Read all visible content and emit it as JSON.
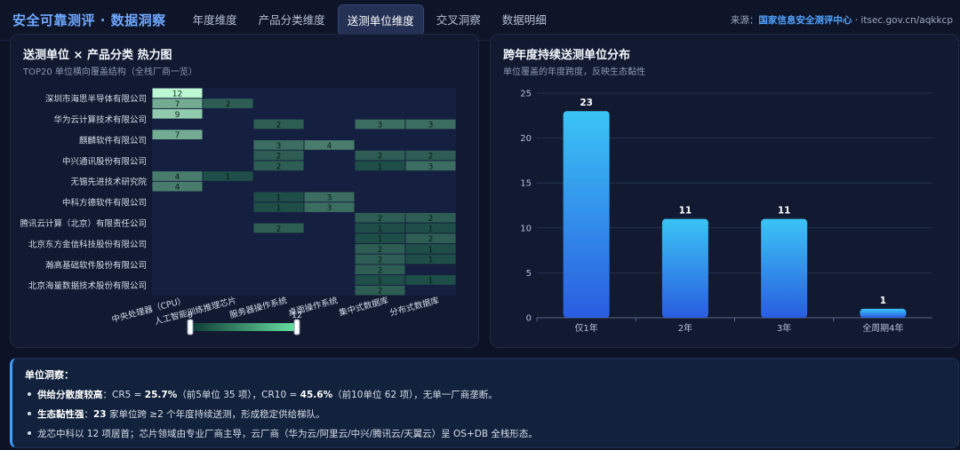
{
  "nav": {
    "brand": "安全可靠测评 · 数据洞察",
    "tabs": [
      "年度维度",
      "产品分类维度",
      "送测单位维度",
      "交叉洞察",
      "数据明细"
    ],
    "active_tab": 2,
    "source_prefix": "来源：",
    "source_org": "国家信息安全测评中心",
    "source_suffix": " · itsec.gov.cn/aqkkcp"
  },
  "heatmap_panel": {
    "title": "送测单位 × 产品分类 热力图",
    "subtitle": "TOP20 单位横向覆盖结构（全栈厂商一览）"
  },
  "bar_panel": {
    "title": "跨年度持续送测单位分布",
    "subtitle": "单位覆盖的年度跨度，反映生态黏性"
  },
  "chart_data": [
    {
      "type": "heatmap",
      "title": "送测单位 × 产品分类 热力图",
      "columns": [
        "中央处理器（CPU）",
        "人工智能训练推理芯片",
        "服务器操作系统",
        "桌面操作系统",
        "集中式数据库",
        "分布式数据库"
      ],
      "row_labels": [
        "深圳市海思半导体有限公司",
        "华为云计算技术有限公司",
        "麒麟软件有限公司",
        "中兴通讯股份有限公司",
        "无锡先进技术研究院",
        "中科方德软件有限公司",
        "腾讯云计算（北京）有限责任公司",
        "北京东方金信科技股份有限公司",
        "瀚高基础软件股份有限公司",
        "北京海量数据技术股份有限公司"
      ],
      "rows": [
        [
          12,
          0,
          0,
          0,
          0,
          0
        ],
        [
          7,
          2,
          0,
          0,
          0,
          0
        ],
        [
          9,
          0,
          0,
          0,
          0,
          0
        ],
        [
          0,
          0,
          2,
          0,
          3,
          3
        ],
        [
          7,
          0,
          0,
          0,
          0,
          0
        ],
        [
          0,
          0,
          3,
          4,
          0,
          0
        ],
        [
          0,
          0,
          2,
          0,
          2,
          2
        ],
        [
          0,
          0,
          2,
          0,
          1,
          3
        ],
        [
          4,
          1,
          0,
          0,
          0,
          0
        ],
        [
          4,
          0,
          0,
          0,
          0,
          0
        ],
        [
          0,
          0,
          1,
          3,
          0,
          0
        ],
        [
          0,
          0,
          1,
          3,
          0,
          0
        ],
        [
          0,
          0,
          0,
          0,
          2,
          2
        ],
        [
          0,
          0,
          2,
          0,
          1,
          1
        ],
        [
          0,
          0,
          0,
          0,
          1,
          2
        ],
        [
          0,
          0,
          0,
          0,
          2,
          1
        ],
        [
          0,
          0,
          0,
          0,
          2,
          1
        ],
        [
          0,
          0,
          0,
          0,
          2,
          0
        ],
        [
          0,
          0,
          0,
          0,
          1,
          1
        ],
        [
          0,
          0,
          0,
          0,
          2,
          0
        ]
      ],
      "visual_map": {
        "min": 0,
        "max": 12,
        "min_label": "0",
        "max_label": "12"
      }
    },
    {
      "type": "bar",
      "title": "跨年度持续送测单位分布",
      "categories": [
        "仅1年",
        "2年",
        "3年",
        "全周期4年"
      ],
      "values": [
        23,
        11,
        11,
        1
      ],
      "ylim": [
        0,
        25
      ],
      "yticks": [
        0,
        5,
        10,
        15,
        20,
        25
      ]
    }
  ],
  "insight": {
    "title": "单位洞察：",
    "lines": [
      {
        "bold": "供给分散度较高",
        "text": "：CR5 = ",
        "b2": "25.7%",
        "t2": "（前5单位 35 项），CR10 = ",
        "b3": "45.6%",
        "t3": "（前10单位 62 项），无单一厂商垄断。"
      },
      {
        "bold": "生态黏性强",
        "text": "：",
        "b2": "23",
        "t2": " 家单位跨 ≥2 个年度持续送测，形成稳定供给梯队。",
        "b3": "",
        "t3": ""
      },
      {
        "bold": "",
        "text": "龙芯中科以 12 项居首；芯片领域由专业厂商主导，云厂商（华为云/阿里云/中兴/腾讯云/天翼云）呈 OS+DB 全栈形态。",
        "b2": "",
        "t2": "",
        "b3": "",
        "t3": ""
      }
    ]
  }
}
